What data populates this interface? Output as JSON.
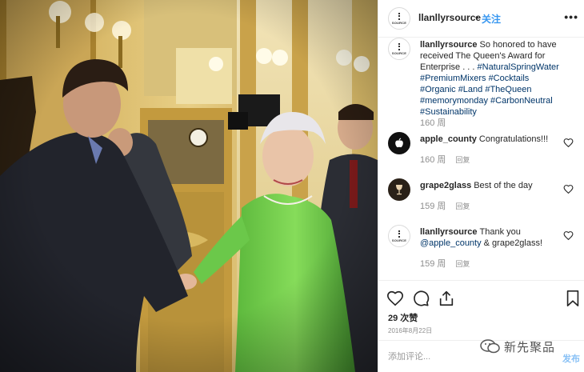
{
  "post": {
    "username": "llanllyrsource",
    "separator": "•",
    "follow_label": "关注",
    "more_icon": "more-horizontal-icon",
    "avatar_text": "SOURCE"
  },
  "caption": {
    "username": "llanllyrsource",
    "text": "So honored to have received The Queen's Award for Enterprise . . . ",
    "hashtags": "#NaturalSpringWater #PremiumMixers #Cocktails #Organic #Land #TheQueen #memorymonday #CarbonNeutral #Sustainability",
    "time": "160 周"
  },
  "comments": [
    {
      "username": "apple_county",
      "text": "Congratulations!!!",
      "time": "160 周",
      "reply_label": "回复"
    },
    {
      "username": "grape2glass",
      "text": "Best of the day",
      "time": "159 周",
      "reply_label": "回复"
    },
    {
      "username": "llanllyrsource",
      "text": "Thank you ",
      "mention": "@apple_county",
      "text_tail": " & grape2glass!",
      "time": "159 周",
      "reply_label": "回复"
    }
  ],
  "actions": {
    "likes": "29 次赞",
    "date": "2016年8月22日",
    "icons": [
      "heart-icon",
      "comment-icon",
      "share-icon",
      "bookmark-icon"
    ]
  },
  "add_comment": {
    "placeholder": "添加评论...",
    "post_label": "发布"
  },
  "watermark": {
    "text": "新先聚品"
  },
  "colors": {
    "link_blue": "#3897f0",
    "hashtag": "#003569",
    "muted": "#8e8e8e",
    "border": "#efefef"
  }
}
